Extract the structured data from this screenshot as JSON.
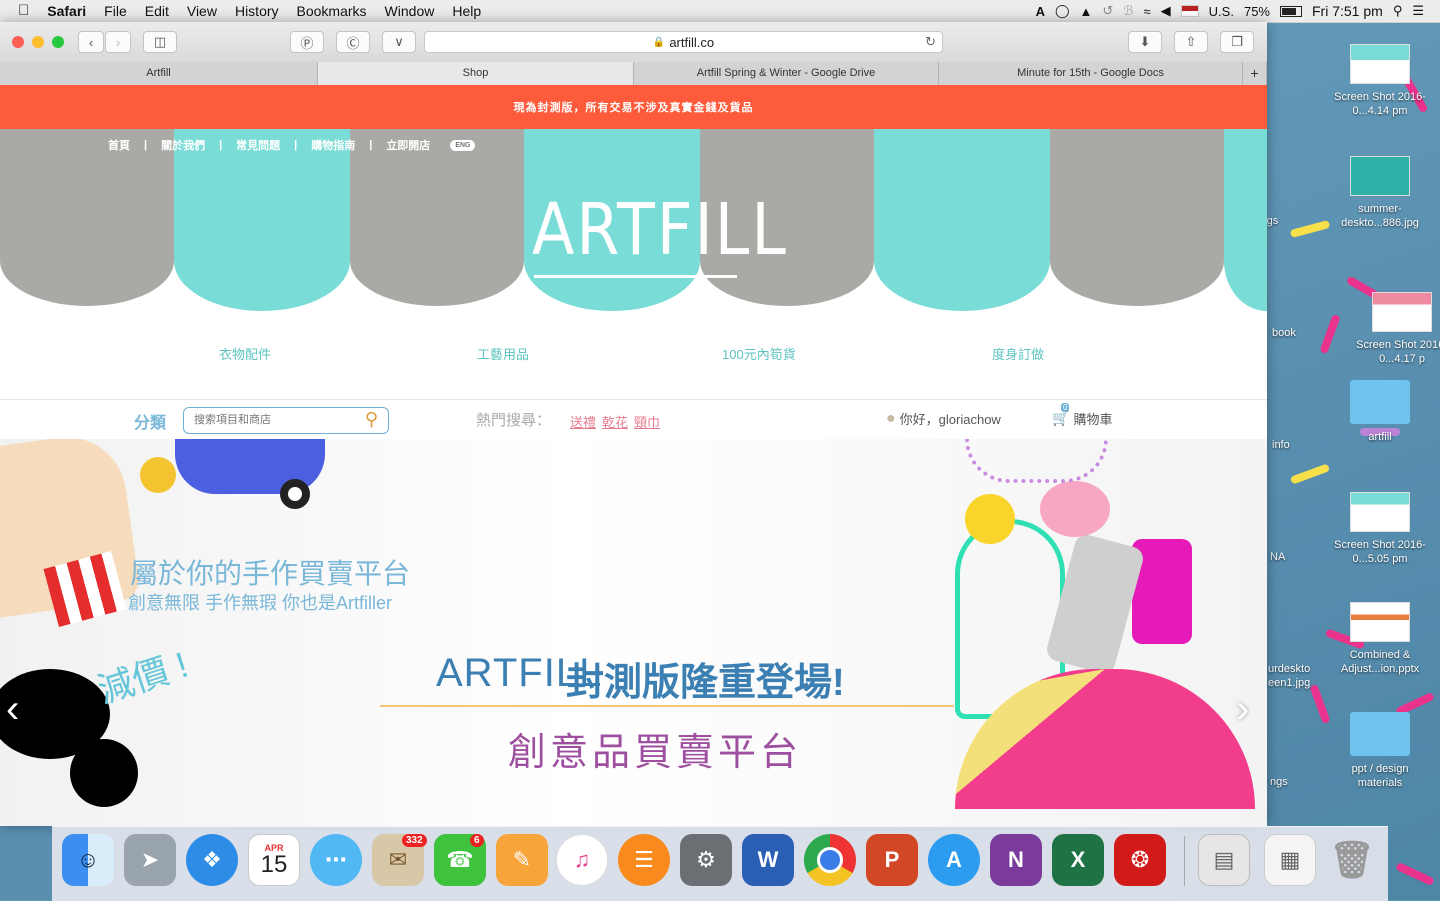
{
  "menubar": {
    "app": "Safari",
    "items": [
      "File",
      "Edit",
      "View",
      "History",
      "Bookmarks",
      "Window",
      "Help"
    ],
    "input_source": "U.S.",
    "battery": "75%",
    "clock": "Fri 7:51 pm"
  },
  "browser": {
    "url": "artfill.co",
    "tabs": [
      "Artfill",
      "Shop",
      "Artfill Spring & Winter - Google Drive",
      "Minute for 15th - Google Docs"
    ],
    "new_tab": "+"
  },
  "site": {
    "notice": "現為封測版，所有交易不涉及真實金錢及貨品",
    "nav": [
      "首頁",
      "關於我們",
      "常見問題",
      "購物指南",
      "立即開店"
    ],
    "lang": "ENG",
    "logo": "ARTFILL",
    "categories": [
      "衣物配件",
      "工藝用品",
      "100元內筍貨",
      "度身訂做"
    ],
    "category_label": "分類",
    "search_placeholder": "搜索項目和商店",
    "hot_label": "熱門搜尋：",
    "hot_tags": [
      "送禮",
      "乾花",
      "頸巾"
    ],
    "greeting": "你好，gloriachow",
    "cart_label": "購物車",
    "cart_count": "0",
    "banner": {
      "tagline1": "屬於你的手作買賣平台",
      "tagline2": "創意無限 手作無瑕 你也是Artfiller",
      "sale": "減價 !",
      "headline_logo": "ARTFILL",
      "headline": "封測版隆重登場!",
      "subhead": "創意品買賣平台"
    }
  },
  "desktop": {
    "items": [
      {
        "label": "Screen Shot 2016-0...4.14 pm",
        "kind": "screenshot"
      },
      {
        "label": "summer-deskto...886.jpg",
        "kind": "image"
      },
      {
        "label": "Screen Shot 2016-0...4.17 p",
        "kind": "screenshot"
      },
      {
        "label": "artfill",
        "kind": "folder"
      },
      {
        "label": "Screen Shot 2016-0...5.05 pm",
        "kind": "screenshot"
      },
      {
        "label": "Combined & Adjust...ion.pptx",
        "kind": "pptx"
      },
      {
        "label": "ppt / design materials",
        "kind": "folder"
      }
    ],
    "partial_labels": [
      "hings",
      "book",
      "info",
      "NA",
      "urdeskto een1.jpg",
      "ngs"
    ]
  },
  "dock": {
    "apps": [
      "Finder",
      "Launchpad",
      "Safari",
      "Calendar",
      "Messages",
      "Mail",
      "FaceTime",
      "Pages",
      "iTunes",
      "iBooks",
      "System Preferences",
      "Word",
      "Chrome",
      "PowerPoint",
      "App Store",
      "OneNote",
      "Excel",
      "Acrobat",
      "Documents",
      "Downloads",
      "Trash"
    ],
    "calendar_month": "APR",
    "calendar_day": "15",
    "mail_badge": "332",
    "facetime_badge": "6"
  },
  "colors": {
    "accent_red": "#fd5b3c",
    "teal": "#7adcd6",
    "grey": "#a9a9a5",
    "link_blue": "#7ab7d8",
    "pink": "#e57b8c"
  }
}
